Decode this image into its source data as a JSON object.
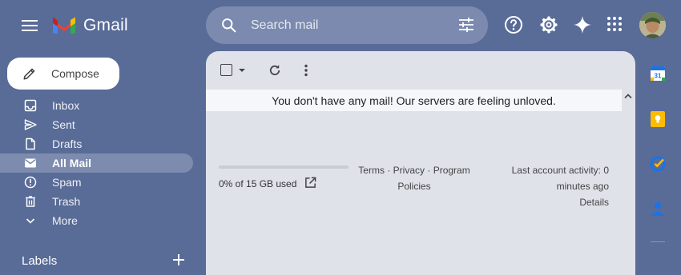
{
  "app": {
    "name": "Gmail",
    "brand_colors": {
      "red": "#ea4335",
      "blue": "#4285f4",
      "green": "#34a853",
      "yellow": "#fbbc04"
    }
  },
  "search": {
    "placeholder": "Search mail",
    "value": ""
  },
  "header_icons": [
    "menu-icon",
    "search-icon",
    "tune-icon",
    "help-icon",
    "settings-icon",
    "gemini-icon",
    "apps-grid-icon"
  ],
  "compose": {
    "label": "Compose",
    "icon": "pencil-icon"
  },
  "nav": {
    "items": [
      {
        "label": "Inbox",
        "icon": "inbox-icon",
        "active": false
      },
      {
        "label": "Sent",
        "icon": "send-icon",
        "active": false
      },
      {
        "label": "Drafts",
        "icon": "draft-icon",
        "active": false
      },
      {
        "label": "All Mail",
        "icon": "mail-icon",
        "active": true
      },
      {
        "label": "Spam",
        "icon": "spam-icon",
        "active": false
      },
      {
        "label": "Trash",
        "icon": "trash-icon",
        "active": false
      },
      {
        "label": "More",
        "icon": "chevron-down-icon",
        "active": false
      }
    ],
    "labels_heading": "Labels"
  },
  "main": {
    "empty_message": "You don't have any mail! Our servers are feeling unloved.",
    "storage": {
      "text": "0% of 15 GB used",
      "used_fraction": 0.0
    },
    "footer": {
      "terms": "Terms",
      "privacy": "Privacy",
      "program_policies": "Program Policies",
      "separator": "·"
    },
    "activity": {
      "text": "Last account activity: 0 minutes ago",
      "details": "Details"
    }
  },
  "side_panel": {
    "apps": [
      {
        "name": "Calendar",
        "icon": "calendar-icon",
        "badge": "31",
        "color": "#1a73e8"
      },
      {
        "name": "Keep",
        "icon": "keep-icon",
        "color": "#fbbc04"
      },
      {
        "name": "Tasks",
        "icon": "tasks-icon",
        "color": "#1a73e8"
      },
      {
        "name": "Contacts",
        "icon": "contacts-icon",
        "color": "#1a73e8"
      }
    ]
  },
  "theme": {
    "background": "#596b97",
    "panel": "#dfe2e9",
    "active_nav": "#7d8bae",
    "search_bg": "#7b8aae"
  }
}
